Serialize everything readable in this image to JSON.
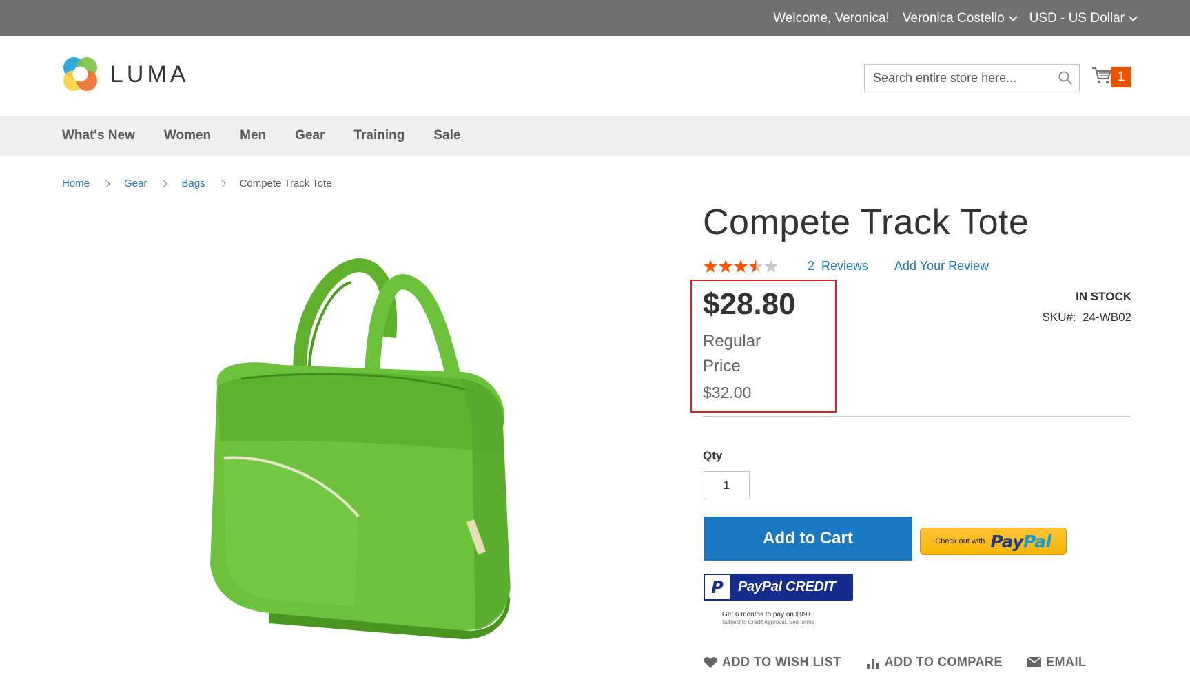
{
  "header": {
    "welcome": "Welcome, Veronica!",
    "account_name": "Veronica Costello",
    "currency": "USD - US Dollar",
    "logo_text": "LUMA",
    "search_placeholder": "Search entire store here...",
    "cart_count": "1"
  },
  "nav": {
    "items": [
      {
        "label": "What's New"
      },
      {
        "label": "Women"
      },
      {
        "label": "Men"
      },
      {
        "label": "Gear"
      },
      {
        "label": "Training"
      },
      {
        "label": "Sale"
      }
    ]
  },
  "breadcrumbs": {
    "items": [
      "Home",
      "Gear",
      "Bags"
    ],
    "current": "Compete Track Tote"
  },
  "product": {
    "title": "Compete Track Tote",
    "rating_stars": 3.5,
    "rating_max": 5,
    "reviews_count": "2",
    "reviews_label": "Reviews",
    "add_review": "Add Your Review",
    "final_price": "$28.80",
    "regular_price_label": "Regular Price",
    "regular_price": "$32.00",
    "stock": "IN STOCK",
    "sku_label": "SKU#:",
    "sku": "24-WB02",
    "qty_label": "Qty",
    "qty_value": "1",
    "add_to_cart": "Add to Cart"
  },
  "paypal": {
    "checkout_small": "Check out with",
    "logo_part1": "Pay",
    "logo_part2": "Pal",
    "credit_label": "PayPal CREDIT",
    "credit_note": "Get 6 months to pay on $99+",
    "credit_sub": "Subject to Credit Approval. See terms"
  },
  "actions": {
    "wishlist": "ADD TO WISH LIST",
    "compare": "ADD TO COMPARE",
    "email": "EMAIL"
  },
  "colors": {
    "top_bar": "#6e716e",
    "link": "#1979c3",
    "primary_button": "#1979c3",
    "cart_badge": "#eb5202",
    "star": "#ff5501",
    "highlight_box": "#e02020",
    "product_green": "#6cc23a"
  }
}
